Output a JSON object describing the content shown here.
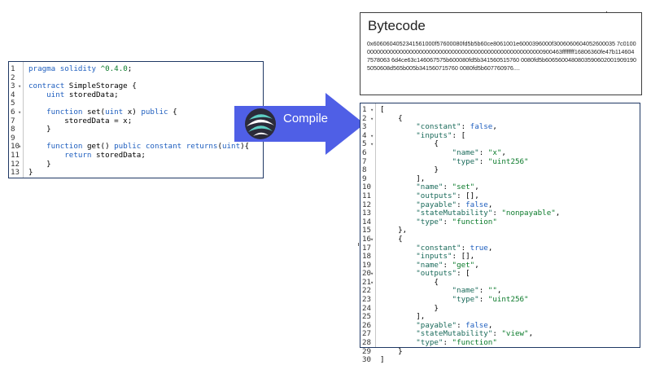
{
  "solidity": {
    "lines": [
      "pragma solidity ^0.4.0;",
      "",
      "contract SimpleStorage {",
      "    uint storedData;",
      "",
      "    function set(uint x) public {",
      "        storedData = x;",
      "    }",
      "",
      "    function get() public constant returns(uint){",
      "        return storedData;",
      "    }",
      "}"
    ],
    "fold_lines": [
      3,
      6,
      10
    ]
  },
  "arrow": {
    "label": "Compile",
    "color": "#4f5fe6"
  },
  "bytecode": {
    "title": "Bytecode",
    "text": "0x6060604052341561000f57600080fd5b5b60ce8061001e6000396000f3006060604052600035 7c0100000000000000000000000000000000000000000000000000000000900463ffffffff16806360fe47b1146047578063 6d4ce63c146067575b600080fd5b341560515760 0080fd5b60656004808035906020019091905050608d565b005b341560715760 0080fd5b607760976...."
  },
  "abi": {
    "lines": [
      "[",
      "    {",
      "        \"constant\": false,",
      "        \"inputs\": [",
      "            {",
      "                \"name\": \"x\",",
      "                \"type\": \"uint256\"",
      "            }",
      "        ],",
      "        \"name\": \"set\",",
      "        \"outputs\": [],",
      "        \"payable\": false,",
      "        \"stateMutability\": \"nonpayable\",",
      "        \"type\": \"function\"",
      "    },",
      "    {",
      "        \"constant\": true,",
      "        \"inputs\": [],",
      "        \"name\": \"get\",",
      "        \"outputs\": [",
      "            {",
      "                \"name\": \"\",",
      "                \"type\": \"uint256\"",
      "            }",
      "        ],",
      "        \"payable\": false,",
      "        \"stateMutability\": \"view\",",
      "        \"type\": \"function\"",
      "    }",
      "]"
    ],
    "fold_lines": [
      1,
      2,
      4,
      5,
      16,
      20,
      21
    ]
  }
}
